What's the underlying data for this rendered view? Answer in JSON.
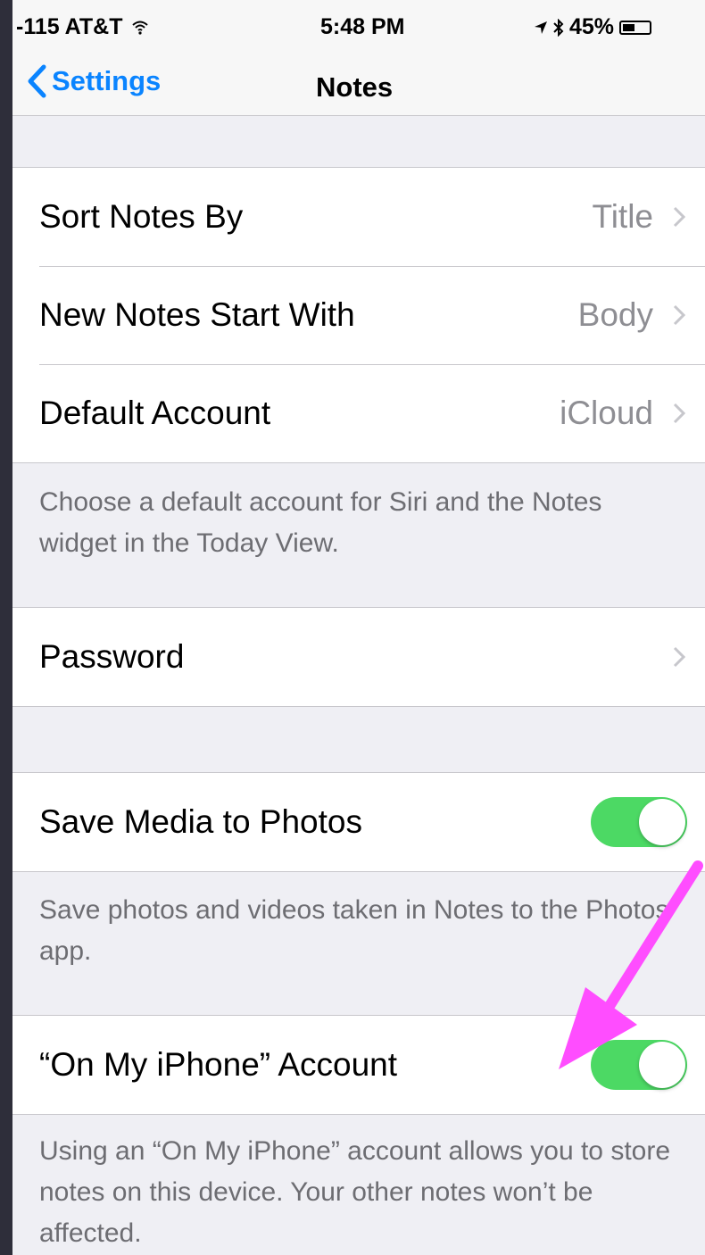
{
  "status_bar": {
    "carrier": "-115 AT&T",
    "time": "5:48 PM",
    "battery": "45%",
    "battery_level": 0.45
  },
  "nav": {
    "back_label": "Settings",
    "title": "Notes"
  },
  "group1": {
    "rows": [
      {
        "title": "Sort Notes By",
        "value": "Title"
      },
      {
        "title": "New Notes Start With",
        "value": "Body"
      },
      {
        "title": "Default Account",
        "value": "iCloud"
      }
    ],
    "footer": "Choose a default account for Siri and the Notes widget in the Today View."
  },
  "group2": {
    "rows": [
      {
        "title": "Password"
      }
    ]
  },
  "group3": {
    "rows": [
      {
        "title": "Save Media to Photos",
        "on": true
      }
    ],
    "footer": "Save photos and videos taken in Notes to the Photos app."
  },
  "group4": {
    "rows": [
      {
        "title": "“On My iPhone” Account",
        "on": true
      }
    ],
    "footer": "Using an “On My iPhone” account allows you to store notes on this device. Your other notes won’t be affected."
  },
  "colors": {
    "accent": "#0a84ff",
    "toggle_on": "#4cd964",
    "annotation_arrow": "#ff4dff"
  },
  "icons": [
    "wifi-icon",
    "location-icon",
    "bluetooth-icon",
    "battery-icon",
    "back-chevron-icon",
    "chevron-right-icon",
    "annotation-arrow"
  ]
}
